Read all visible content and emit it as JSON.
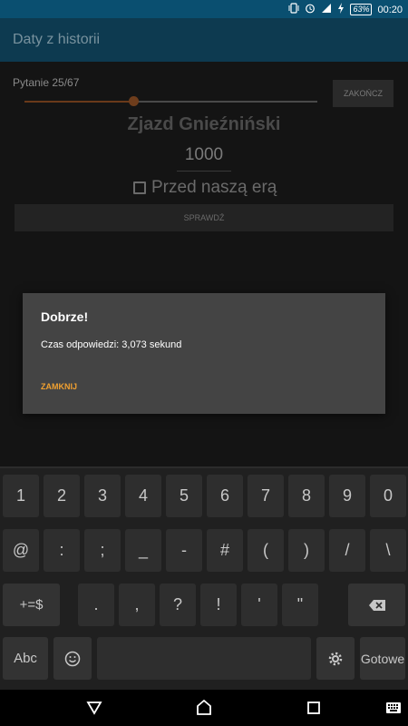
{
  "status_bar": {
    "battery": "63%",
    "time": "00:20"
  },
  "app_bar": {
    "title": "Daty z historii"
  },
  "quiz": {
    "question_counter": "Pytanie 25/67",
    "progress_fraction": 0.37,
    "finish_label": "ZAKOŃCZ",
    "event_title": "Zjazd Gnieźniński",
    "year_value": "1000",
    "bc_label": "Przed naszą erą",
    "check_label": "SPRAWDŹ"
  },
  "dialog": {
    "title": "Dobrze!",
    "message": "Czas odpowiedzi: 3,073 sekund",
    "close_label": "ZAMKNIJ"
  },
  "keyboard": {
    "row1": [
      "1",
      "2",
      "3",
      "4",
      "5",
      "6",
      "7",
      "8",
      "9",
      "0"
    ],
    "row2": [
      "@",
      ":",
      ";",
      "_",
      "-",
      "#",
      "(",
      ")",
      "/",
      "\\"
    ],
    "row3": [
      "+=$",
      ".",
      ",",
      "?",
      "!",
      "'",
      "\""
    ],
    "abc_label": "Abc",
    "done_label": "Gotowe"
  },
  "colors": {
    "accent": "#f0a030",
    "status_bar": "#0a4f70",
    "app_bar": "#0d3a50"
  }
}
